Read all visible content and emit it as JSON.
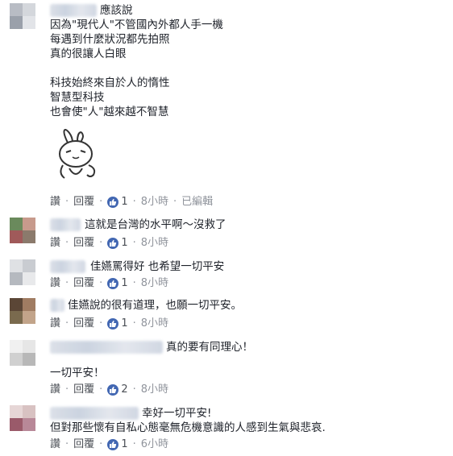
{
  "comments": [
    {
      "lines": [
        "應該說",
        "因為\"現代人\"不管國內外都人手一機",
        "每遇到什麼狀況都先拍照",
        "真的很讓人白眼",
        "",
        "科技始終來自於人的惰性",
        "智慧型科技",
        "也會使\"人\"越來越不智慧"
      ],
      "reply": "讚",
      "respond": "回覆",
      "likes": "1",
      "time": "8小時",
      "edited": "已編輯"
    },
    {
      "lines": [
        "這就是台灣的水平啊～沒救了"
      ],
      "reply": "讚",
      "respond": "回覆",
      "likes": "1",
      "time": "8小時"
    },
    {
      "lines": [
        "佳嬿罵得好 也希望一切平安"
      ],
      "reply": "讚",
      "respond": "回覆",
      "likes": "1",
      "time": "8小時"
    },
    {
      "lines": [
        "佳嬿說的很有道理，也願一切平安。"
      ],
      "reply": "讚",
      "respond": "回覆",
      "likes": "1",
      "time": "8小時"
    },
    {
      "lines": [
        "真的要有同理心！",
        "",
        "一切平安！"
      ],
      "reply": "讚",
      "respond": "回覆",
      "likes": "2",
      "time": "8小時"
    },
    {
      "lines": [
        "幸好一切平安!",
        "但對那些懷有自私心態毫無危機意識的人感到生氣與悲哀."
      ],
      "reply": "讚",
      "respond": "回覆",
      "likes": "1",
      "time": "6小時"
    }
  ],
  "colors": {
    "link": "#4b4f56",
    "like": "#4267b2",
    "meta": "#90949c",
    "text": "#1d2129"
  }
}
